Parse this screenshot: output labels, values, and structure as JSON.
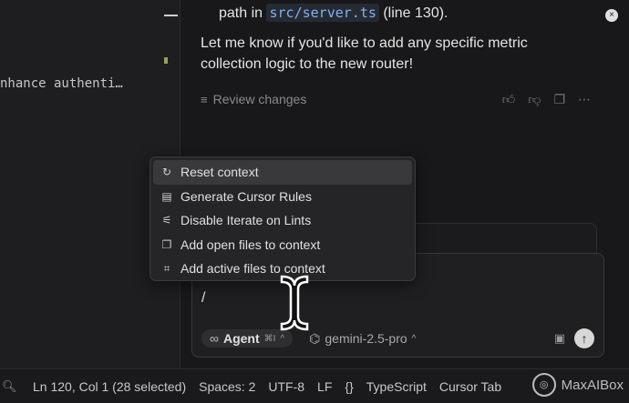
{
  "editor": {
    "code_fragment": "nhance authenti…"
  },
  "chat": {
    "line1_prefix": "path in ",
    "line1_code": "src/server.ts",
    "line1_suffix": " (line 130).",
    "message": "Let me know if you'd like to add any specific metric collection logic to the new router!",
    "review_label": "Review changes",
    "close_glyph": "×"
  },
  "menu": {
    "items": [
      {
        "label": "Reset context",
        "icon": "reset-icon",
        "glyph": "↻"
      },
      {
        "label": "Generate Cursor Rules",
        "icon": "file-icon",
        "glyph": "▤"
      },
      {
        "label": "Disable Iterate on Lints",
        "icon": "sliders-icon",
        "glyph": "⚟"
      },
      {
        "label": "Add open files to context",
        "icon": "files-icon",
        "glyph": "❐"
      },
      {
        "label": "Add active files to context",
        "icon": "code-file-icon",
        "glyph": "⌗"
      }
    ]
  },
  "input": {
    "value": "/",
    "agent_label": "Agent",
    "agent_glyph": "∞",
    "agent_shortcut": "⌘I",
    "model_label": "gemini-2.5-pro",
    "model_glyph": "⌬"
  },
  "status": {
    "position": "Ln 120, Col 1 (28 selected)",
    "spaces": "Spaces: 2",
    "encoding": "UTF-8",
    "eol": "LF",
    "language_glyph": "{}",
    "language": "TypeScript",
    "cursor_tab": "Cursor Tab",
    "watermark": "MaxAIBox"
  }
}
